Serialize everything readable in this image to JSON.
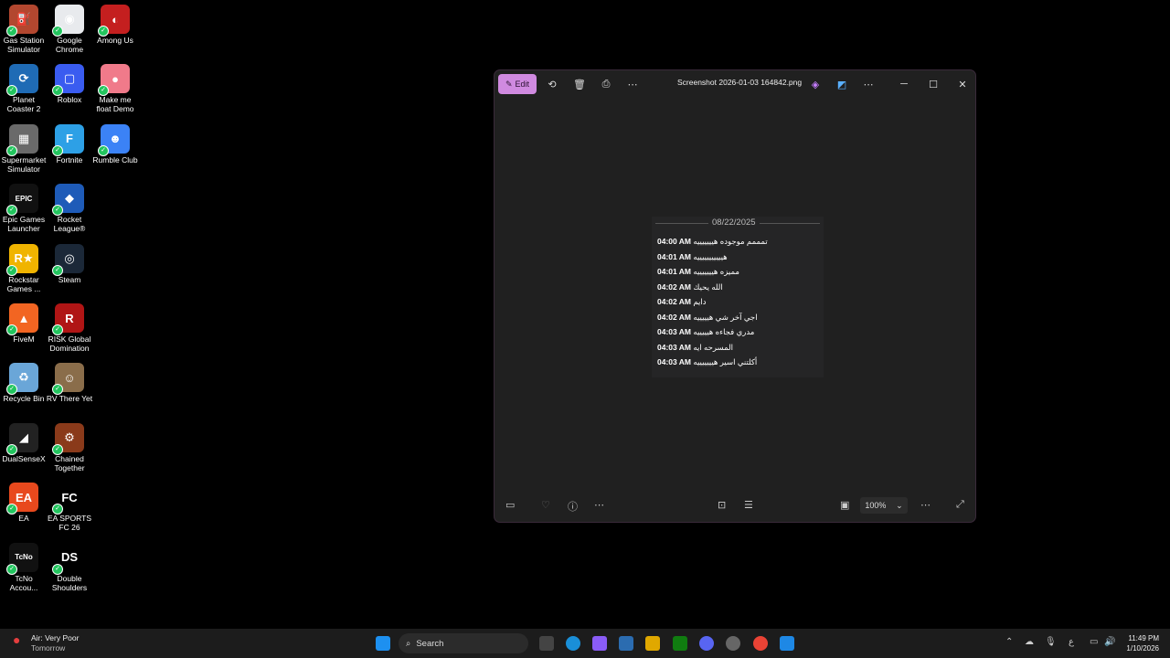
{
  "desktop": {
    "icons": [
      {
        "label": "Gas Station\nSimulator",
        "icon": "gas-station-simulator-icon",
        "color": "#b3472f",
        "glyph": "⛽"
      },
      {
        "label": "Google\nChrome",
        "icon": "chrome-icon",
        "color": "#e8eaed",
        "glyph": "◉"
      },
      {
        "label": "Among Us",
        "icon": "among-us-icon",
        "color": "#c41f1f",
        "glyph": "◐"
      },
      {
        "label": "Planet\nCoaster 2",
        "icon": "planet-coaster-icon",
        "color": "#1f6bb5",
        "glyph": "⟳"
      },
      {
        "label": "Roblox",
        "icon": "roblox-icon",
        "color": "#3a5cf0",
        "glyph": "▢"
      },
      {
        "label": "Make me\nfloat Demo",
        "icon": "make-me-float-icon",
        "color": "#f07a8a",
        "glyph": "●"
      },
      {
        "label": "Supermarket\nSimulator",
        "icon": "supermarket-simulator-icon",
        "color": "#6a6a6a",
        "glyph": "▦"
      },
      {
        "label": "Fortnite",
        "icon": "fortnite-icon",
        "color": "#2da0e6",
        "glyph": "F"
      },
      {
        "label": "Rumble Club",
        "icon": "rumble-club-icon",
        "color": "#3b82f6",
        "glyph": "☻"
      },
      {
        "label": "Epic Games\nLauncher",
        "icon": "epic-games-icon",
        "color": "#111111",
        "glyph": "EPIC"
      },
      {
        "label": "Rocket\nLeague®",
        "icon": "rocket-league-icon",
        "color": "#1e5bb8",
        "glyph": "◆"
      },
      {
        "label": "Rockstar\nGames ...",
        "icon": "rockstar-icon",
        "color": "#f0b400",
        "glyph": "R★"
      },
      {
        "label": "Steam",
        "icon": "steam-icon",
        "color": "#1b2838",
        "glyph": "◎"
      },
      {
        "label": "FiveM",
        "icon": "fivem-icon",
        "color": "#f26522",
        "glyph": "▲"
      },
      {
        "label": "RISK Global\nDomination",
        "icon": "risk-icon",
        "color": "#b01515",
        "glyph": "R"
      },
      {
        "label": "Recycle Bin",
        "icon": "recycle-bin-icon",
        "color": "#6aa6d8",
        "glyph": "♻"
      },
      {
        "label": "RV There Yet",
        "icon": "rv-there-yet-icon",
        "color": "#8a6d4a",
        "glyph": "☺"
      },
      {
        "label": "DualSenseX",
        "icon": "dualsensex-icon",
        "color": "#222222",
        "glyph": "◢"
      },
      {
        "label": "Chained\nTogether",
        "icon": "chained-together-icon",
        "color": "#8a3a1a",
        "glyph": "⚙"
      },
      {
        "label": "EA",
        "icon": "ea-icon",
        "color": "#e8491d",
        "glyph": "EA"
      },
      {
        "label": "EA SPORTS\nFC 26",
        "icon": "ea-fc26-icon",
        "color": "#000000",
        "glyph": "FC"
      },
      {
        "label": "TcNo\nAccou...",
        "icon": "tcno-icon",
        "color": "#111111",
        "glyph": "TcNo"
      },
      {
        "label": "Double\nShoulders",
        "icon": "double-shoulders-icon",
        "color": "#000000",
        "glyph": "DS"
      }
    ]
  },
  "window": {
    "edit_label": "Edit",
    "title": "Screenshot 2026-01-03 164842.png",
    "zoom": "100%"
  },
  "image": {
    "date": "08/22/2025",
    "messages": [
      {
        "time": "04:00 AM",
        "text": "تمممم موجوده هيييييييه"
      },
      {
        "time": "04:01 AM",
        "text": "هيييييييييييه"
      },
      {
        "time": "04:01 AM",
        "text": "مميزه هيييييييه"
      },
      {
        "time": "04:02 AM",
        "text": "الله يحيك"
      },
      {
        "time": "04:02 AM",
        "text": "دايم"
      },
      {
        "time": "04:02 AM",
        "text": "اجي آخر شي هيييييه"
      },
      {
        "time": "04:03 AM",
        "text": "مدري فجاءه هيييييه"
      },
      {
        "time": "04:03 AM",
        "text": "المسرحه ايه"
      },
      {
        "time": "04:03 AM",
        "text": "أكلتني اسير هيييييييه"
      }
    ]
  },
  "taskbar": {
    "weather_title": "Air: Very Poor",
    "weather_sub": "Tomorrow",
    "search_label": "Search",
    "time": "11:49 PM",
    "date": "1/10/2026",
    "lang": "ع"
  }
}
